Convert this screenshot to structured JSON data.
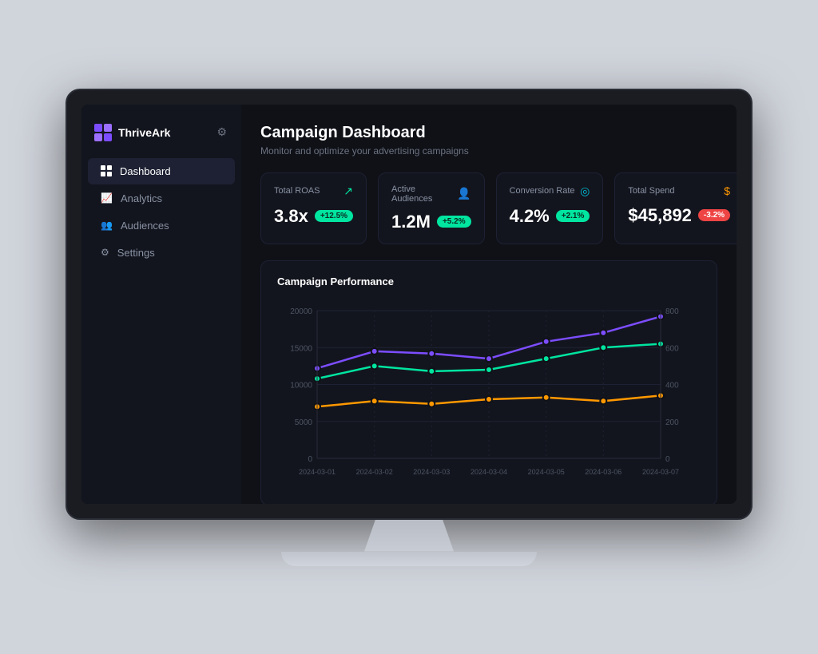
{
  "app": {
    "name": "ThriveArk"
  },
  "sidebar": {
    "logo": "ThriveArk",
    "nav_items": [
      {
        "id": "dashboard",
        "label": "Dashboard",
        "icon": "⊞",
        "active": true
      },
      {
        "id": "analytics",
        "label": "Analytics",
        "icon": "📊",
        "active": false
      },
      {
        "id": "audiences",
        "label": "Audiences",
        "icon": "👥",
        "active": false
      },
      {
        "id": "settings",
        "label": "Settings",
        "icon": "⚙",
        "active": false
      }
    ]
  },
  "page": {
    "title": "Campaign Dashboard",
    "subtitle": "Monitor and optimize your advertising campaigns"
  },
  "metrics": [
    {
      "id": "total-roas",
      "label": "Total ROAS",
      "value": "3.8x",
      "badge": "+12.5%",
      "badge_type": "positive",
      "icon": "↗",
      "icon_class": "green"
    },
    {
      "id": "active-audiences",
      "label": "Active Audiences",
      "value": "1.2M",
      "badge": "+5.2%",
      "badge_type": "positive",
      "icon": "👤",
      "icon_class": "purple"
    },
    {
      "id": "conversion-rate",
      "label": "Conversion Rate",
      "value": "4.2%",
      "badge": "+2.1%",
      "badge_type": "positive",
      "icon": "◎",
      "icon_class": "teal"
    },
    {
      "id": "total-spend",
      "label": "Total Spend",
      "value": "$45,892",
      "badge": "-3.2%",
      "badge_type": "negative",
      "icon": "$",
      "icon_class": "orange"
    }
  ],
  "chart": {
    "title": "Campaign Performance",
    "x_labels": [
      "2024-03-01",
      "2024-03-02",
      "2024-03-03",
      "2024-03-04",
      "2024-03-05",
      "2024-03-06",
      "2024-03-07"
    ],
    "y_left_labels": [
      "0",
      "5000",
      "10000",
      "15000",
      "20000"
    ],
    "y_right_labels": [
      "0",
      "200",
      "400",
      "600",
      "800"
    ],
    "series": [
      {
        "id": "impressions",
        "color": "#7c4dff",
        "points": [
          12200,
          14500,
          14200,
          13500,
          15800,
          17000,
          19200
        ]
      },
      {
        "id": "clicks",
        "color": "#00e5a0",
        "points": [
          10800,
          12500,
          11800,
          12000,
          13500,
          15000,
          15500
        ]
      },
      {
        "id": "conversions",
        "color": "#ff9800",
        "points": [
          280,
          310,
          295,
          320,
          330,
          310,
          340
        ]
      }
    ]
  }
}
